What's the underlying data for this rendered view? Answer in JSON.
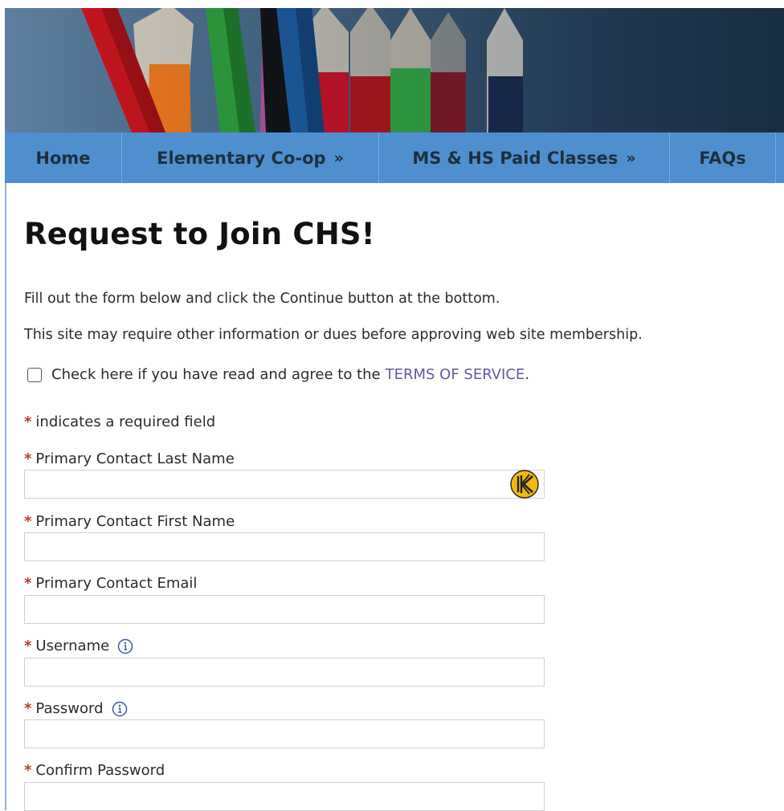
{
  "nav": {
    "items": [
      {
        "label": "Home",
        "has_arrow": false
      },
      {
        "label": "Elementary Co-op",
        "has_arrow": true
      },
      {
        "label": "MS & HS Paid Classes",
        "has_arrow": true
      },
      {
        "label": "FAQs",
        "has_arrow": false
      }
    ],
    "arrow": "»"
  },
  "page": {
    "title": "Request to Join CHS!",
    "intro1": "Fill out the form below and click the Continue button at the bottom.",
    "intro2": "This site may require other information or dues before approving web site membership."
  },
  "terms": {
    "checked": false,
    "text": "Check here if you have read and agree to the",
    "link": "TERMS OF SERVICE",
    "suffix": "."
  },
  "form": {
    "required_marker": "*",
    "required_note": "indicates a required field",
    "fields": [
      {
        "label": "Primary Contact Last Name",
        "value": "",
        "info": false
      },
      {
        "label": "Primary Contact First Name",
        "value": "",
        "info": false
      },
      {
        "label": "Primary Contact Email",
        "value": "",
        "info": false
      },
      {
        "label": "Username",
        "value": "",
        "info": true
      },
      {
        "label": "Password",
        "value": "",
        "info": true
      },
      {
        "label": "Confirm Password",
        "value": "",
        "info": false
      }
    ]
  },
  "colors": {
    "nav_background": "#4f8fcf",
    "required": "#c0392b",
    "link": "#5f5aa0",
    "keeper_icon": "#f2b90f"
  },
  "icons": {
    "info": "info-circle-icon",
    "password_manager": "keeper-icon"
  }
}
